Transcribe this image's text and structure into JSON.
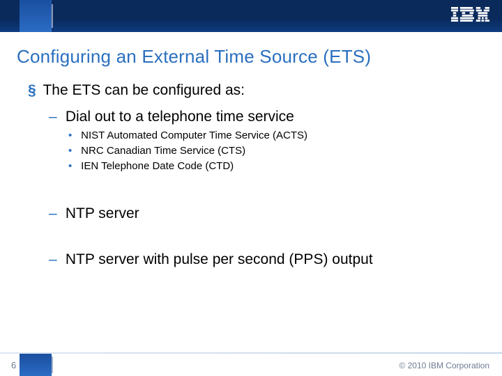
{
  "brand": {
    "logo_alt": "IBM"
  },
  "slide": {
    "title": "Configuring an External Time Source (ETS)",
    "page_number": "6",
    "copyright": "© 2010 IBM Corporation"
  },
  "content": {
    "lvl1_text": "The ETS can be configured as:",
    "items": [
      {
        "text": "Dial out to a telephone time service",
        "sub": [
          "NIST Automated Computer Time Service (ACTS)",
          "NRC Canadian Time Service (CTS)",
          "IEN Telephone Date Code (CTD)"
        ]
      },
      {
        "text": "NTP server",
        "sub": []
      },
      {
        "text": "NTP server with pulse per second (PPS) output",
        "sub": []
      }
    ]
  },
  "bullets": {
    "square": "§",
    "dash": "–",
    "dot": "•"
  }
}
